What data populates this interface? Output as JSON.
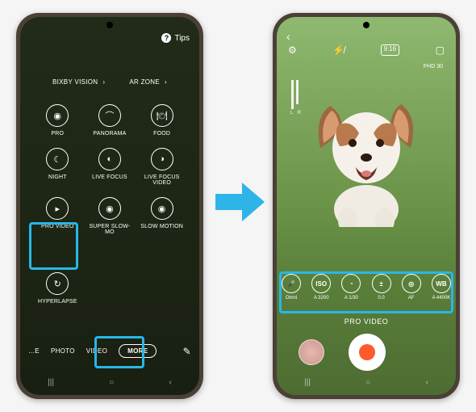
{
  "left": {
    "tips_label": "Tips",
    "quick": {
      "bixby": "BIXBY VISION",
      "arzone": "AR ZONE"
    },
    "modes": {
      "pro": "PRO",
      "panorama": "PANORAMA",
      "food": "FOOD",
      "night": "NIGHT",
      "live_focus": "LIVE FOCUS",
      "live_focus_video": "LIVE FOCUS VIDEO",
      "pro_video": "PRO VIDEO",
      "super_slow_mo": "SUPER SLOW-MO",
      "slow_motion": "SLOW MOTION",
      "hyperlapse": "HYPERLAPSE"
    },
    "tabs": {
      "e": "…E",
      "photo": "PHOTO",
      "video": "VIDEO",
      "more": "MORE"
    }
  },
  "right": {
    "resolution_badge": "9:16",
    "resolution_label": "FHD 30",
    "audio_label": "L  R",
    "controls": {
      "mic": {
        "label": "Omni"
      },
      "iso": {
        "icon": "ISO",
        "label": "A 3200"
      },
      "shutter": {
        "label": "A 1/30"
      },
      "ev": {
        "label": "0.0"
      },
      "focus": {
        "label": "AF"
      },
      "wb": {
        "icon": "WB",
        "label": "A 4400K"
      }
    },
    "mode_label": "PRO VIDEO"
  }
}
